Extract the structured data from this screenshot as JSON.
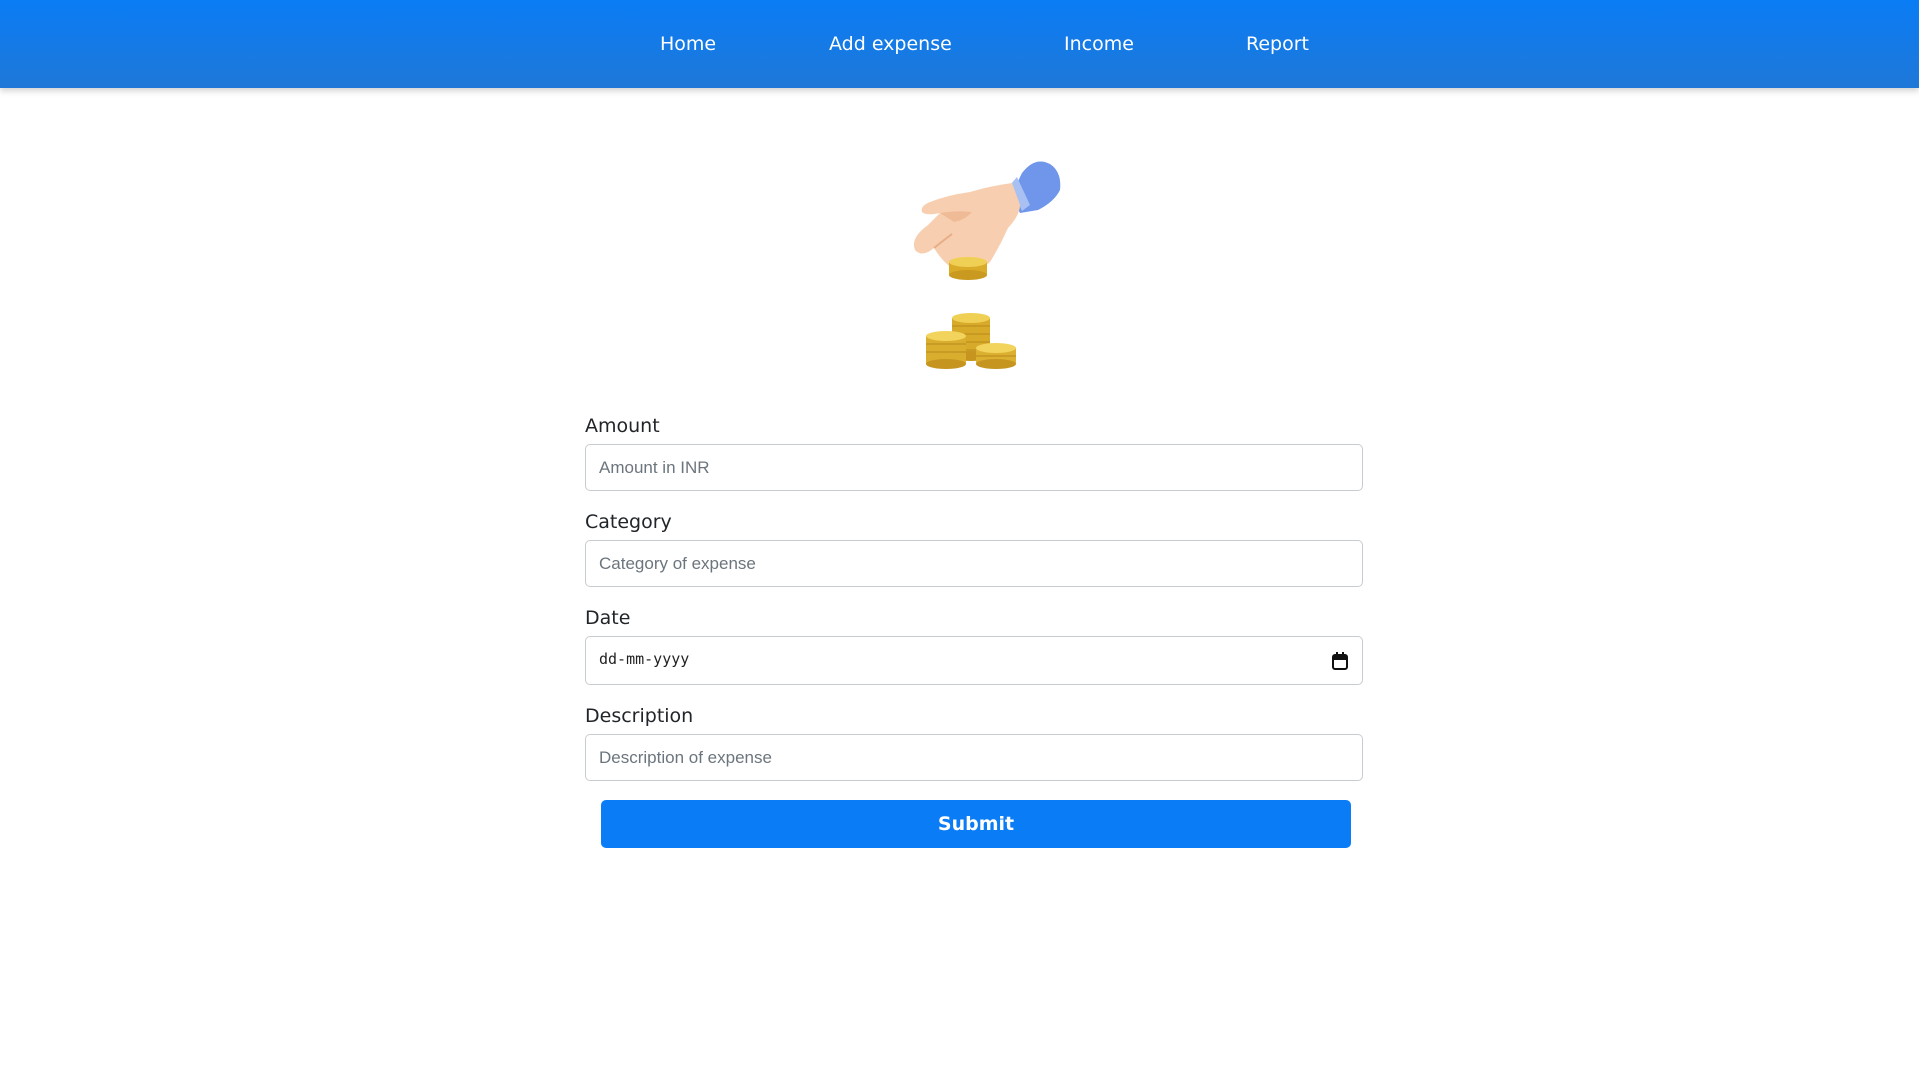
{
  "nav": {
    "items": [
      {
        "label": "Home"
      },
      {
        "label": "Add expense"
      },
      {
        "label": "Income"
      },
      {
        "label": "Report"
      }
    ]
  },
  "illustration": {
    "icon": "hand-placing-coins-icon",
    "colors": {
      "skin": "#f7cfb0",
      "sleeve": "#6f96ea",
      "coin": "#e9c23c"
    }
  },
  "form": {
    "amount": {
      "label": "Amount",
      "placeholder": "Amount in INR",
      "value": ""
    },
    "category": {
      "label": "Category",
      "placeholder": "Category of expense",
      "value": ""
    },
    "date": {
      "label": "Date",
      "placeholder": "dd-mm-yyyy",
      "value": ""
    },
    "description": {
      "label": "Description",
      "placeholder": "Description of expense",
      "value": ""
    },
    "submit_label": "Submit"
  },
  "colors": {
    "accent": "#0a7cf5",
    "nav_background": "#1f78d8",
    "input_border": "#c7ccd1"
  }
}
